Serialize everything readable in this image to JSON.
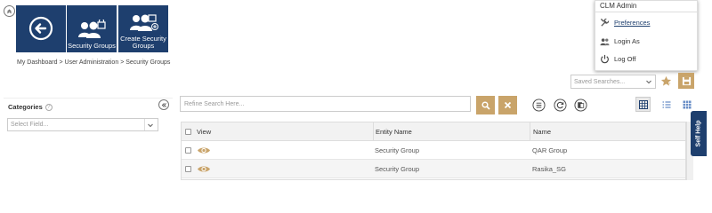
{
  "tiles": {
    "back_label": "",
    "security_groups": "Security Groups",
    "create_security_groups": "Create Security Groups"
  },
  "breadcrumb": {
    "items": [
      "My Dashboard",
      "User Administration",
      "Security Groups"
    ],
    "separator": ">"
  },
  "admin_menu": {
    "title": "CLM Admin",
    "preferences": "Preferences",
    "login_as": "Login As",
    "log_off": "Log Off"
  },
  "saved_searches": {
    "placeholder": "Saved Searches..."
  },
  "categories": {
    "label": "Categories",
    "help": "?",
    "select_placeholder": "Select Field..."
  },
  "search": {
    "placeholder": "Refine Search Here..."
  },
  "grid": {
    "columns": [
      "View",
      "Entity Name",
      "Name"
    ],
    "rows": [
      {
        "entity": "Security Group",
        "name": "QAR Group"
      },
      {
        "entity": "Security Group",
        "name": "Rasika_SG"
      }
    ]
  },
  "self_help": {
    "label": "Self Help"
  },
  "colors": {
    "brand_navy": "#1e3f6e",
    "accent_gold": "#c9a46a"
  },
  "icons": [
    "collapse-up-icon",
    "back-arrow-icon",
    "group-lock-icon",
    "group-lock-add-icon",
    "tools-icon",
    "users-icon",
    "power-icon",
    "star-icon",
    "save-icon",
    "search-icon",
    "clear-icon",
    "list-circle-icon",
    "refresh-circle-icon",
    "export-icon",
    "grid-view-icon",
    "list-view-icon",
    "tile-view-icon",
    "eye-icon",
    "chevron-down-icon"
  ]
}
